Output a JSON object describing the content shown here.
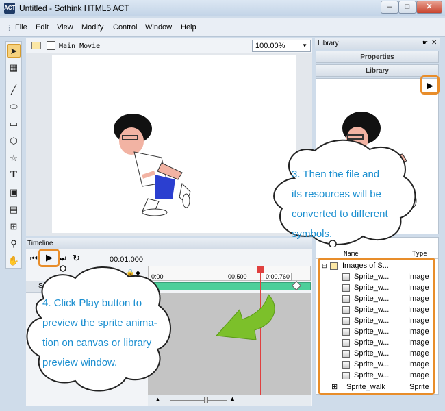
{
  "window": {
    "title": "Untitled - Sothink HTML5 ACT",
    "app_icon": "ACT"
  },
  "menu": [
    "File",
    "Edit",
    "View",
    "Modify",
    "Control",
    "Window",
    "Help"
  ],
  "stage": {
    "scene": "Main Movie",
    "zoom": "100.00%"
  },
  "timeline": {
    "title": "Timeline",
    "time": "00:01.000",
    "layer": "Sprite_walk",
    "ruler": [
      "0:00",
      "00.500",
      "0:00.760"
    ]
  },
  "library": {
    "panel_title": "Library",
    "tabs": [
      "Properties",
      "Library"
    ],
    "columns": [
      "Name",
      "Type"
    ],
    "folder": "Images of S...",
    "items": [
      {
        "name": "Sprite_w...",
        "type": "Image"
      },
      {
        "name": "Sprite_w...",
        "type": "Image"
      },
      {
        "name": "Sprite_w...",
        "type": "Image"
      },
      {
        "name": "Sprite_w...",
        "type": "Image"
      },
      {
        "name": "Sprite_w...",
        "type": "Image"
      },
      {
        "name": "Sprite_w...",
        "type": "Image"
      },
      {
        "name": "Sprite_w...",
        "type": "Image"
      },
      {
        "name": "Sprite_w...",
        "type": "Image"
      },
      {
        "name": "Sprite_w...",
        "type": "Image"
      },
      {
        "name": "Sprite_w...",
        "type": "Image"
      }
    ],
    "sprite": {
      "name": "Sprite_walk",
      "type": "Sprite"
    }
  },
  "callouts": {
    "step3": [
      "3. Then the file and",
      "its resources will be",
      "converted to different",
      "symbols."
    ],
    "step4": [
      "4. Click Play button to",
      "preview the sprite anima-",
      "tion on canvas or library",
      "preview window."
    ]
  },
  "colors": {
    "accent_orange": "#e88d2a",
    "callout_text": "#1b8fd0",
    "track_green": "#4ccf9a",
    "playhead_red": "#e0403f"
  }
}
